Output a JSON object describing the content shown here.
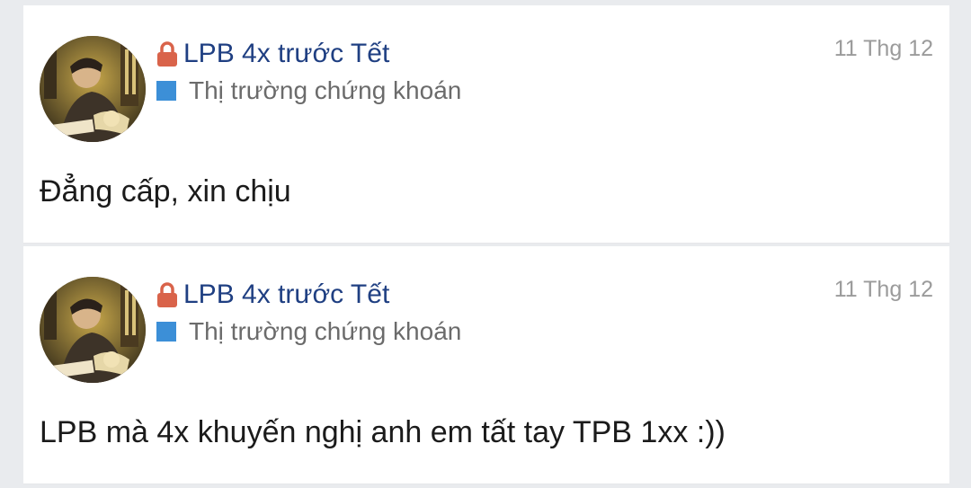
{
  "posts": [
    {
      "title": "LPB 4x trước Tết",
      "category": "Thị trường chứng khoán",
      "date": "11 Thg 12",
      "body": "Đẳng cấp, xin chịu",
      "locked": true
    },
    {
      "title": "LPB 4x trước Tết",
      "category": "Thị trường chứng khoán",
      "date": "11 Thg 12",
      "body": "LPB mà 4x khuyến nghị anh em tất tay TPB 1xx :))",
      "locked": true
    }
  ],
  "colors": {
    "title": "#1f3f82",
    "lock": "#d9634a",
    "category_square": "#3c8fd7",
    "date": "#9b9b9b",
    "background": "#e9ebee"
  },
  "icons": {
    "lock": "lock-icon",
    "category": "category-square-icon",
    "avatar": "user-avatar"
  }
}
